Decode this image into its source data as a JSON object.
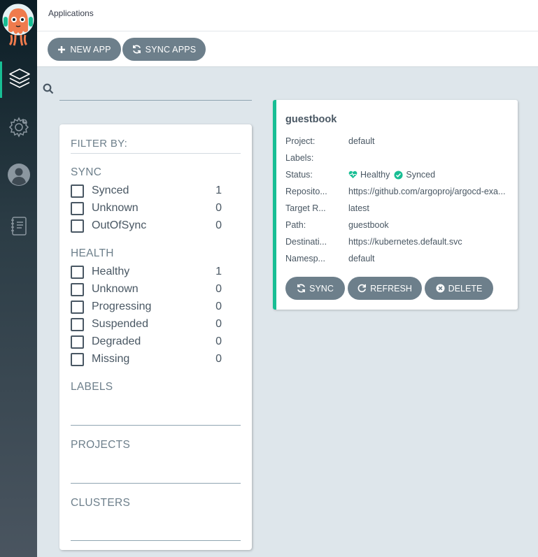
{
  "header": {
    "title": "Applications"
  },
  "toolbar": {
    "new_app_label": "NEW APP",
    "sync_apps_label": "SYNC APPS"
  },
  "search": {
    "value": "",
    "placeholder": ""
  },
  "filter": {
    "title": "FILTER BY:",
    "sync": {
      "title": "SYNC",
      "items": [
        {
          "label": "Synced",
          "count": "1"
        },
        {
          "label": "Unknown",
          "count": "0"
        },
        {
          "label": "OutOfSync",
          "count": "0"
        }
      ]
    },
    "health": {
      "title": "HEALTH",
      "items": [
        {
          "label": "Healthy",
          "count": "1"
        },
        {
          "label": "Unknown",
          "count": "0"
        },
        {
          "label": "Progressing",
          "count": "0"
        },
        {
          "label": "Suspended",
          "count": "0"
        },
        {
          "label": "Degraded",
          "count": "0"
        },
        {
          "label": "Missing",
          "count": "0"
        }
      ]
    },
    "labels_title": "LABELS",
    "projects_title": "PROJECTS",
    "clusters_title": "CLUSTERS"
  },
  "app": {
    "name": "guestbook",
    "fields": [
      {
        "label": "Project:",
        "value": "default"
      },
      {
        "label": "Labels:",
        "value": ""
      },
      {
        "label": "Status:",
        "health": "Healthy",
        "sync": "Synced"
      },
      {
        "label": "Reposito...",
        "value": "https://github.com/argoproj/argocd-exa..."
      },
      {
        "label": "Target R...",
        "value": "latest"
      },
      {
        "label": "Path:",
        "value": "guestbook"
      },
      {
        "label": "Destinati...",
        "value": "https://kubernetes.default.svc"
      },
      {
        "label": "Namesp...",
        "value": "default"
      }
    ],
    "buttons": {
      "sync": "SYNC",
      "refresh": "REFRESH",
      "delete": "DELETE"
    }
  },
  "colors": {
    "accent": "#18be94",
    "button": "#6d7f8b",
    "text": "#495763",
    "background": "#dee6eb"
  },
  "icons": [
    "argo-logo-icon",
    "layers-icon",
    "gear-icon",
    "user-icon",
    "docs-icon",
    "search-icon",
    "plus-icon",
    "sync-icon",
    "refresh-icon",
    "times-circle-icon",
    "heart-icon",
    "check-circle-icon"
  ]
}
